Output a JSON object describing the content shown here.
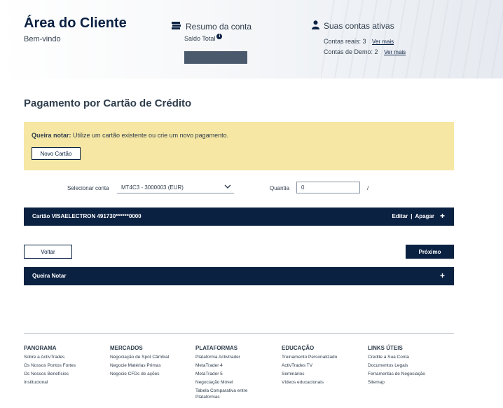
{
  "header": {
    "title": "Área do Cliente",
    "subtitle": "Bem-vindo",
    "summary": {
      "title": "Resumo da conta",
      "saldo_label": "Saldo Total",
      "info_glyph": "i"
    },
    "accounts": {
      "title": "Suas contas ativas",
      "real_label": "Contas reais: 3",
      "demo_label": "Contas de Demo: 2",
      "link_label": "Ver mais"
    }
  },
  "page": {
    "title": "Pagamento por Cartão de Crédito"
  },
  "notice": {
    "bold": "Queira notar:",
    "text": " Utilize um cartão existente ou crie um novo pagamento.",
    "button": "Novo Cartão"
  },
  "form": {
    "account_label": "Selecionar conta",
    "account_value": "MT4C3 - 3000003 (EUR)",
    "amount_label": "Quantia",
    "amount_value": "0",
    "slash": "/"
  },
  "card": {
    "label": "Cartão VISAELECTRON 491730******0000",
    "edit": "Editar",
    "sep": "|",
    "delete": "Apagar",
    "plus": "+"
  },
  "actions": {
    "back": "Voltar",
    "next": "Próximo"
  },
  "notes": {
    "label": "Queira Notar",
    "plus": "+"
  },
  "footer": {
    "columns": [
      {
        "title": "PANORAMA",
        "items": [
          "Sobre a ActivTrades",
          "Os Nossos Pontos Fortes",
          "Os Nossos Benefícios",
          "Institucional"
        ]
      },
      {
        "title": "MERCADOS",
        "items": [
          "Negociação de Spot Câmbial",
          "Negocie Matérias Primas",
          "Negocie CFDs de ações"
        ]
      },
      {
        "title": "PLATAFORMAS",
        "items": [
          "Plataforma Activtrader",
          "MetaTrader 4",
          "MetaTrader 5",
          "Negociação Móvel",
          "Tabela Comparativa entre Plataformas"
        ]
      },
      {
        "title": "EDUCAÇÃO",
        "items": [
          "Treinamento Personalizado",
          "ActivTrades TV",
          "Seminários",
          "Vídeos educacionais"
        ]
      },
      {
        "title": "LINKS ÚTEIS",
        "items": [
          "Credite a Sua Conta",
          "Documentos Legais",
          "Ferramentas de Negociação",
          "Sitemap"
        ]
      }
    ]
  },
  "icons": {
    "summary": "money-stack-icon",
    "accounts": "user-icon",
    "select": "chevron-down-icon"
  },
  "colors": {
    "navy": "#0b2142",
    "notice": "#f6e7a4"
  }
}
